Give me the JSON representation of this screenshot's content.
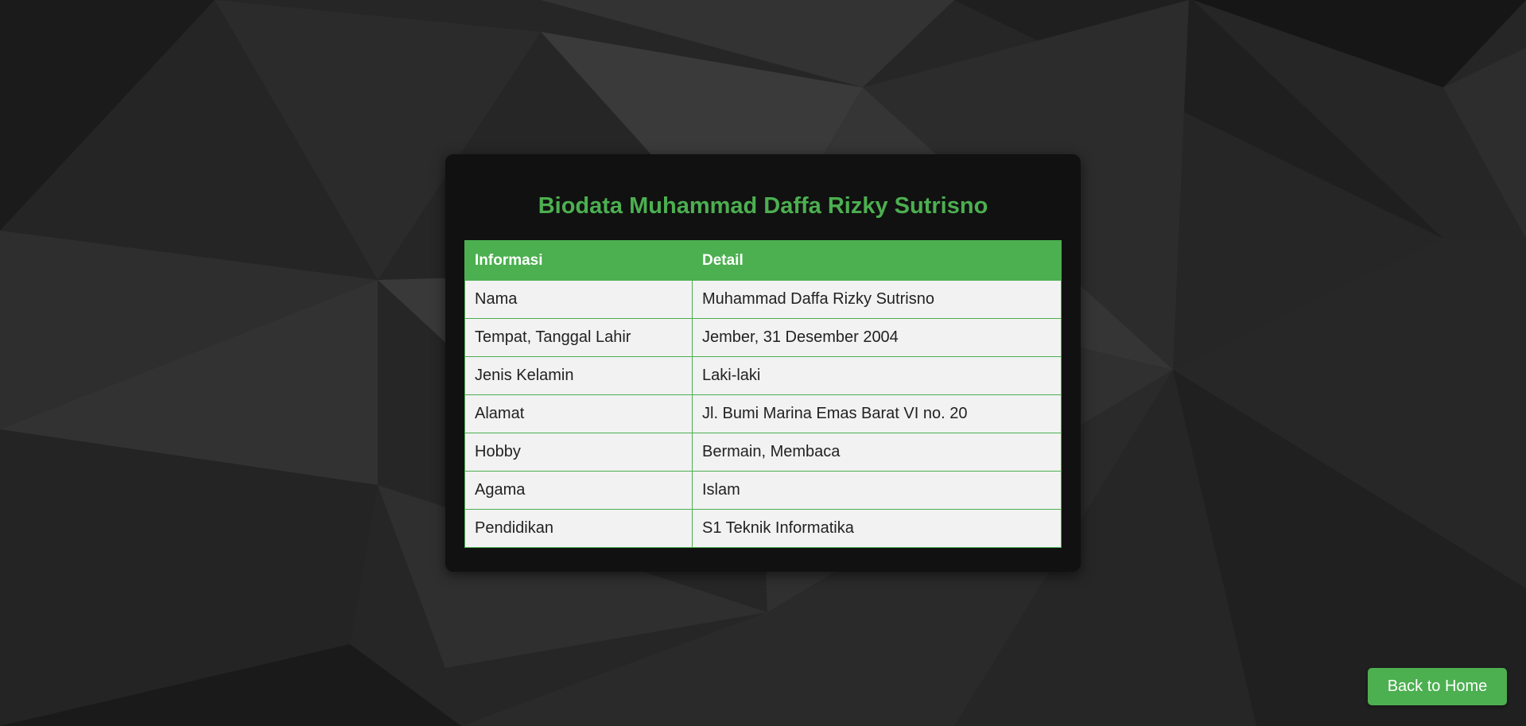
{
  "colors": {
    "accent": "#4caf50",
    "card_background": "#111111",
    "cell_background": "#f2f2f2",
    "page_background": "#2a2a2a"
  },
  "page": {
    "title": "Biodata Muhammad Daffa Rizky Sutrisno"
  },
  "table": {
    "headers": [
      "Informasi",
      "Detail"
    ],
    "rows": [
      [
        "Nama",
        "Muhammad Daffa Rizky Sutrisno"
      ],
      [
        "Tempat, Tanggal Lahir",
        "Jember, 31 Desember 2004"
      ],
      [
        "Jenis Kelamin",
        "Laki-laki"
      ],
      [
        "Alamat",
        "Jl. Bumi Marina Emas Barat VI no. 20"
      ],
      [
        "Hobby",
        "Bermain, Membaca"
      ],
      [
        "Agama",
        "Islam"
      ],
      [
        "Pendidikan",
        "S1 Teknik Informatika"
      ]
    ]
  },
  "nav": {
    "back_home_label": "Back to Home"
  }
}
